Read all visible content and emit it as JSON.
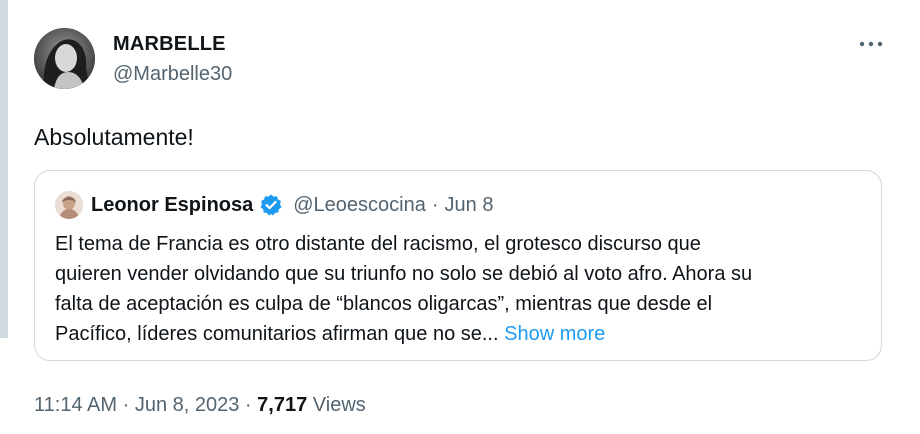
{
  "tweet": {
    "author_name": "MARBELLE",
    "author_handle": "@Marbelle30",
    "text": "Absolutamente!",
    "time": "11:14 AM",
    "date": "Jun 8, 2023",
    "separator": "·",
    "views_count": "7,717",
    "views_label": "Views",
    "more_icon": "more-horizontal-icon"
  },
  "quote": {
    "author_name": "Leonor Espinosa",
    "verified_icon": "verified-badge-icon",
    "author_handle": "@Leoescocina",
    "separator": "·",
    "date": "Jun 8",
    "body_line_1": "El tema de Francia es otro distante del racismo, el grotesco discurso que",
    "body_line_2": "quieren vender olvidando que su triunfo no solo se debió al voto afro. Ahora su",
    "body_line_3": "falta de aceptación es culpa de “blancos oligarcas”, mientras que desde el",
    "body_line_4": "Pacífico, líderes comunitarios afirman que no se... ",
    "show_more": "Show more"
  },
  "colors": {
    "text_primary": "#0f1419",
    "text_secondary": "#536471",
    "link": "#1d9bf0",
    "border": "#cfd9de",
    "verified": "#1d9bf0"
  }
}
